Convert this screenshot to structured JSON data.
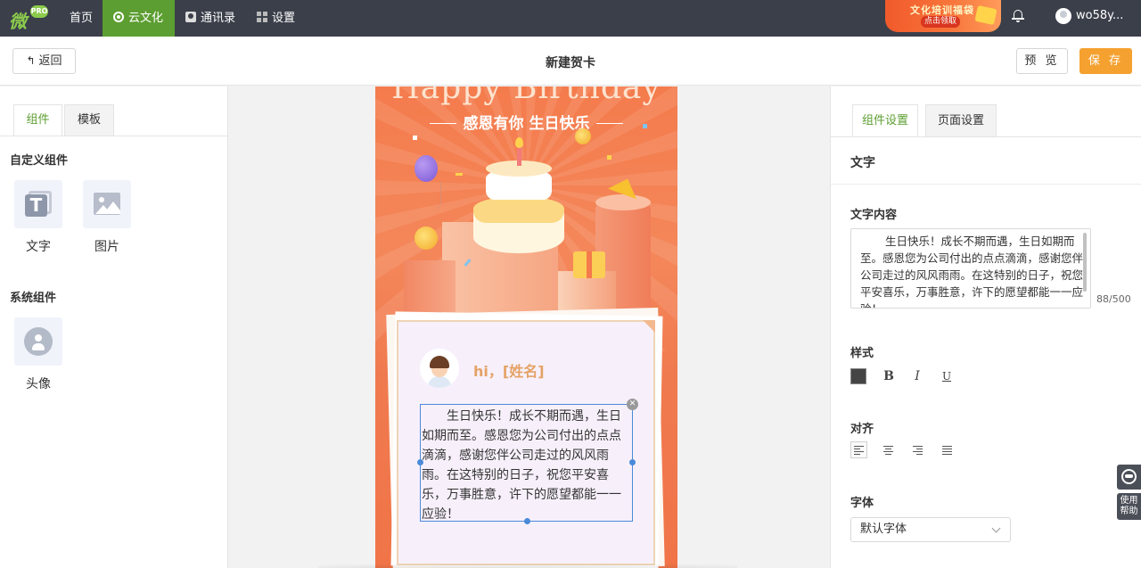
{
  "nav": {
    "logo_badge": "PRO",
    "items": [
      {
        "label": "首页",
        "icon": ""
      },
      {
        "label": "云文化",
        "icon": "cloud-flower-icon"
      },
      {
        "label": "通讯录",
        "icon": "contacts-icon"
      },
      {
        "label": "设置",
        "icon": "grid-icon"
      }
    ],
    "promo": {
      "title": "文化培训福袋",
      "subtitle": "点击领取"
    },
    "username": "wo58y..."
  },
  "toolbar": {
    "back_label": "返回",
    "page_title": "新建贺卡",
    "preview_label": "预 览",
    "save_label": "保 存"
  },
  "left_panel": {
    "tabs": [
      {
        "label": "组件",
        "active": true
      },
      {
        "label": "模板",
        "active": false
      }
    ],
    "custom_section_title": "自定义组件",
    "custom_components": [
      {
        "label": "文字",
        "icon": "text-icon"
      },
      {
        "label": "图片",
        "icon": "image-icon"
      }
    ],
    "system_section_title": "系统组件",
    "system_components": [
      {
        "label": "头像",
        "icon": "avatar-icon"
      }
    ]
  },
  "card": {
    "headline": "Happy Birthday",
    "subheadline": "感恩有你 生日快乐",
    "greeting": "hi，[姓名]",
    "body_text": "生日快乐！成长不期而遇，生日如期而至。感恩您为公司付出的点点滴滴，感谢您伴公司走过的风风雨雨。在这特别的日子，祝您平安喜乐，万事胜意，许下的愿望都能一一应验！"
  },
  "right_panel": {
    "tabs": [
      {
        "label": "组件设置",
        "active": true
      },
      {
        "label": "页面设置",
        "active": false
      }
    ],
    "section_title": "文字",
    "content_label": "文字内容",
    "content_value": "生日快乐！成长不期而遇，生日如期而至。感恩您为公司付出的点点滴滴，感谢您伴公司走过的风风雨雨。在这特别的日子，祝您平安喜乐，万事胜意，许下的愿望都能一一应验！",
    "char_count": "88/500",
    "style_label": "样式",
    "style_buttons": [
      "B",
      "I",
      "U"
    ],
    "text_color": "#444444",
    "align_label": "对齐",
    "align_options": [
      "left",
      "center",
      "right",
      "justify"
    ],
    "align_selected": "left",
    "font_label": "字体",
    "font_value": "默认字体"
  },
  "help": {
    "label": "使用帮助"
  },
  "colors": {
    "nav_bg": "#3a3f4a",
    "nav_active": "#5c9e31",
    "accent_green": "#5c9e31",
    "save_orange": "#f5a130",
    "card_orange": "#f47b4c",
    "selection_blue": "#4a8ad8"
  }
}
